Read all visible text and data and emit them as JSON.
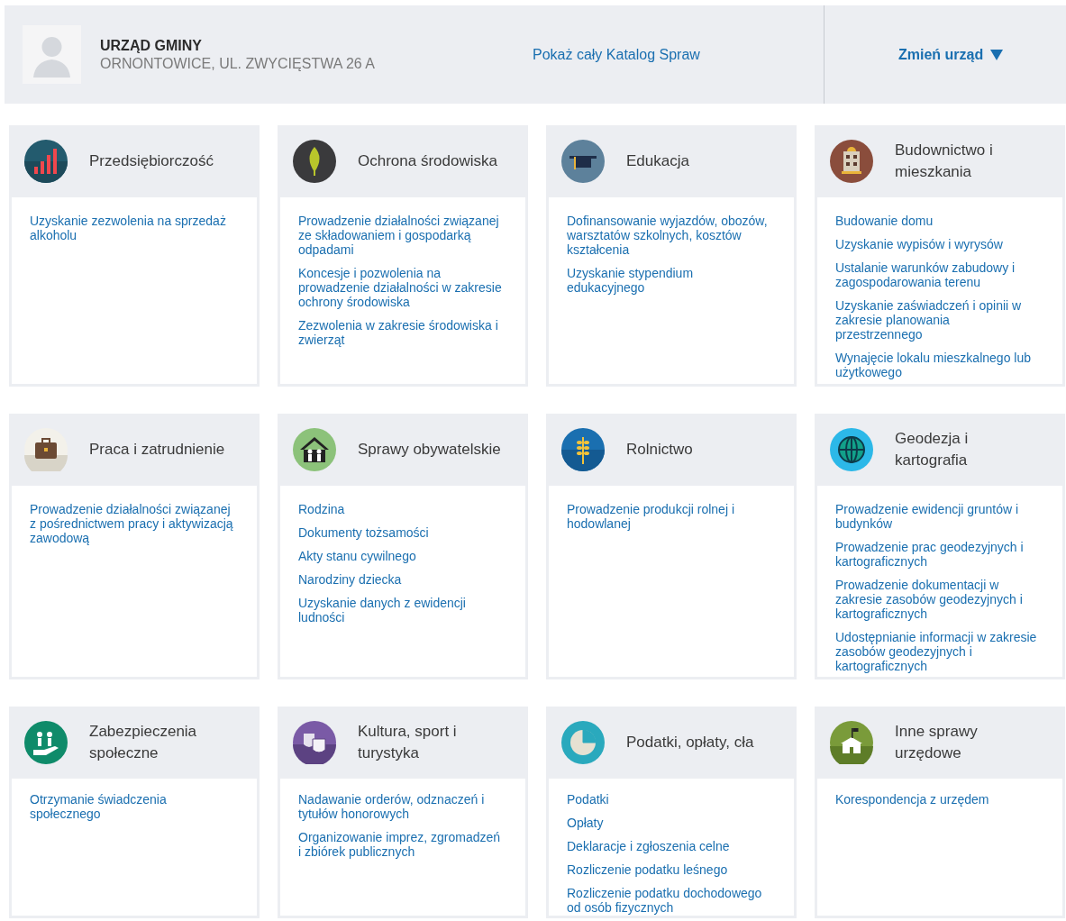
{
  "office": {
    "name": "URZĄD GMINY",
    "address": "ORNONTOWICE, UL. ZWYCIĘSTWA 26 A"
  },
  "catalog_link": "Pokaż cały Katalog Spraw",
  "change_office": "Zmień urząd",
  "categories": [
    {
      "title": "Przedsiębiorczość",
      "links": [
        "Uzyskanie zezwolenia na sprzedaż alkoholu"
      ]
    },
    {
      "title": "Ochrona środowiska",
      "links": [
        "Prowadzenie działalności związanej ze składowaniem i gospodarką odpadami",
        "Koncesje i pozwolenia na prowadzenie działalności w zakresie ochrony środowiska",
        "Zezwolenia w zakresie środowiska i zwierząt"
      ]
    },
    {
      "title": "Edukacja",
      "links": [
        "Dofinansowanie wyjazdów, obozów, warsztatów szkolnych, kosztów kształcenia",
        "Uzyskanie stypendium edukacyjnego"
      ]
    },
    {
      "title": "Budownictwo i mieszkania",
      "links": [
        "Budowanie domu",
        "Uzyskanie wypisów i wyrysów",
        "Ustalanie warunków zabudowy i zagospodarowania terenu",
        "Uzyskanie zaświadczeń i opinii w zakresie planowania przestrzennego",
        "Wynajęcie lokalu mieszkalnego lub użytkowego"
      ]
    },
    {
      "title": "Praca i zatrudnienie",
      "links": [
        "Prowadzenie działalności związanej z pośrednictwem pracy i aktywizacją zawodową"
      ]
    },
    {
      "title": "Sprawy obywatelskie",
      "links": [
        "Rodzina",
        "Dokumenty tożsamości",
        "Akty stanu cywilnego",
        "Narodziny dziecka",
        "Uzyskanie danych z ewidencji ludności"
      ]
    },
    {
      "title": "Rolnictwo",
      "links": [
        "Prowadzenie produkcji rolnej i hodowlanej"
      ]
    },
    {
      "title": "Geodezja i kartografia",
      "links": [
        "Prowadzenie ewidencji gruntów i budynków",
        "Prowadzenie prac geodezyjnych i kartograficznych",
        "Prowadzenie dokumentacji w zakresie zasobów geodezyjnych i kartograficznych",
        "Udostępnianie informacji w zakresie zasobów geodezyjnych i kartograficznych"
      ]
    },
    {
      "title": "Zabezpieczenia społeczne",
      "links": [
        "Otrzymanie świadczenia społecznego"
      ]
    },
    {
      "title": "Kultura, sport i turystyka",
      "links": [
        "Nadawanie orderów, odznaczeń i tytułów honorowych",
        "Organizowanie imprez, zgromadzeń i zbiórek publicznych"
      ]
    },
    {
      "title": "Podatki, opłaty, cła",
      "links": [
        "Podatki",
        "Opłaty",
        "Deklaracje i zgłoszenia celne",
        "Rozliczenie podatku leśnego",
        "Rozliczenie podatku dochodowego od osób fizycznych"
      ]
    },
    {
      "title": "Inne sprawy urzędowe",
      "links": [
        "Korespondencja z urzędem"
      ]
    }
  ]
}
